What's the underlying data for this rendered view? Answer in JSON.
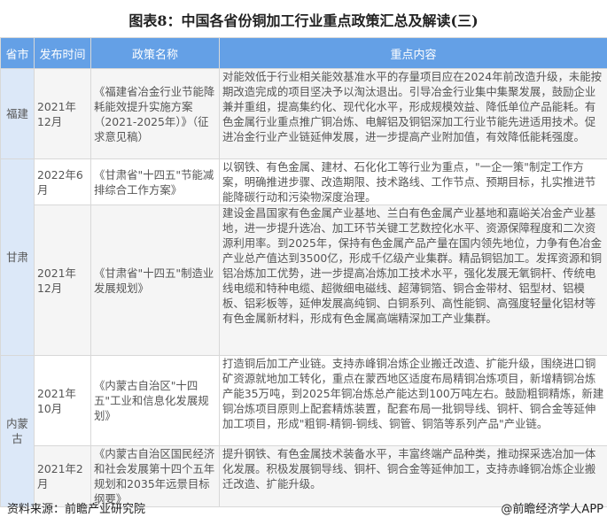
{
  "title": "图表8：中国各省份铜加工行业重点政策汇总及解读(三)",
  "table": {
    "headers": [
      "省市",
      "发布时间",
      "政策名称",
      "重点内容"
    ],
    "rows": [
      {
        "province": "福建",
        "date": "2021年12月",
        "name": "《福建省冶金行业节能降耗能效提升实施方案（2021-2025年）》（征求意见稿）",
        "content": "对能效低于行业相关能效基准水平的存量项目应在2024年前改造升级，未能按期改造完成的项目坚决予以淘汰退出。引导冶金行业集中集聚发展，鼓励企业兼并重组，提高集约化、现代化水平，形成规模效益、降低单位产品能耗。有色金属行业重点推广铜冶炼、电解铝及铜铝深加工行业节能先进适用技术。促进冶金行业产业链延伸发展，进一步提高产业附加值，有效降低能耗强度。"
      },
      {
        "province": "甘肃",
        "date": "2022年6月",
        "name": "《甘肃省\"十四五\"节能减排综合工作方案》",
        "content": "以钢铁、有色金属、建材、石化化工等行业为重点，\"一企一策\"制定工作方案，明确推进步骤、改造期限、技术路线、工作节点、预期目标，扎实推进节能降碳行动和污染物深度治理。"
      },
      {
        "province": "",
        "date": "2021年12月",
        "name": "《甘肃省\"十四五\"制造业发展规划》",
        "content": "建设金昌国家有色金属产业基地、兰白有色金属产业基地和嘉峪关冶金产业基地，进一步提升选冶、加工环节关键工艺数控化水平、资源保障程度和二次资源利用率。到2025年，保持有色金属产品产量在国内领先地位，力争有色冶金产业总产值达到3500亿，形成千亿级产业集群。精品铜铝加工。发挥资源和铜铝冶炼加工优势，进一步提高冶炼加工技术水平，强化发展无氧铜杆、传统电线电缆和特种电缆、超微细电磁线、超薄铜箔、铜合金带材、铝型材、铝模板、铝彩板等，延伸发展高纯铜、白铜系列、高性能铜、高强度轻量化铝材等有色金属新材料，形成有色金属高端精深加工产业集群。"
      },
      {
        "province": "内蒙古",
        "date": "2021年10月",
        "name": "《内蒙古自治区\"十四五\"工业和信息化发展规划》",
        "content": "打造铜后加工产业链。支持赤峰铜冶炼企业搬迁改造、扩能升级，围绕进口铜矿资源就地加工转化，重点在蒙西地区适度布局精铜冶炼项目，新增精铜冶炼产能35万吨，到2025年铜冶炼总产能达到100万吨左右。鼓励粗铜精炼，新建铜冶炼项目原则上配套精炼装置，配套布局一批铜导线、铜杆、铜合金等延伸加工项目，形成\"粗铜-精铜-铜线、铜管、铜箔等系列产品\"产业链。"
      },
      {
        "province": "",
        "date": "2021年2月",
        "name": "《内蒙古自治区国民经济和社会发展第十四个五年规划和2035年远景目标纲要》",
        "content": "提升钢铁、有色金属技术装备水平，丰富终端产品种类，推动探采选冶加一体化发展。积极发展铜导线、铜杆、铜合金等延伸加工，支持赤峰铜冶炼企业搬迁改造、扩能升级。"
      }
    ]
  },
  "footer": {
    "source": "资料来源：前瞻产业研究院",
    "brand": "@前瞻经济学人APP"
  },
  "colors": {
    "header_bg": "#64a0e6",
    "province_bg": "#dce8f8",
    "row_gray": "#f5f5f5"
  }
}
